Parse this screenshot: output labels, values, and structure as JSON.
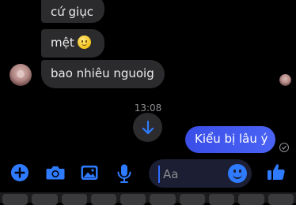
{
  "messages": {
    "received": [
      {
        "text": "cứ giục"
      },
      {
        "text": "mệt",
        "emoji": "slightly-smiling-face"
      },
      {
        "text": "bao nhiêu nguoig"
      }
    ],
    "timestamp": "13:08",
    "sent": [
      {
        "text": "Kiểu bị lâu ý"
      }
    ]
  },
  "composer": {
    "placeholder": "Aa"
  },
  "colors": {
    "accent": "#2f7bff",
    "sent_bubble": "#4457f0",
    "received_bubble": "#2b2b2d",
    "background": "#000000"
  },
  "icons": [
    "plus-icon",
    "camera-icon",
    "photo-icon",
    "microphone-icon",
    "emoji-icon",
    "thumbs-up-icon",
    "arrow-down-icon",
    "sent-check-icon"
  ]
}
